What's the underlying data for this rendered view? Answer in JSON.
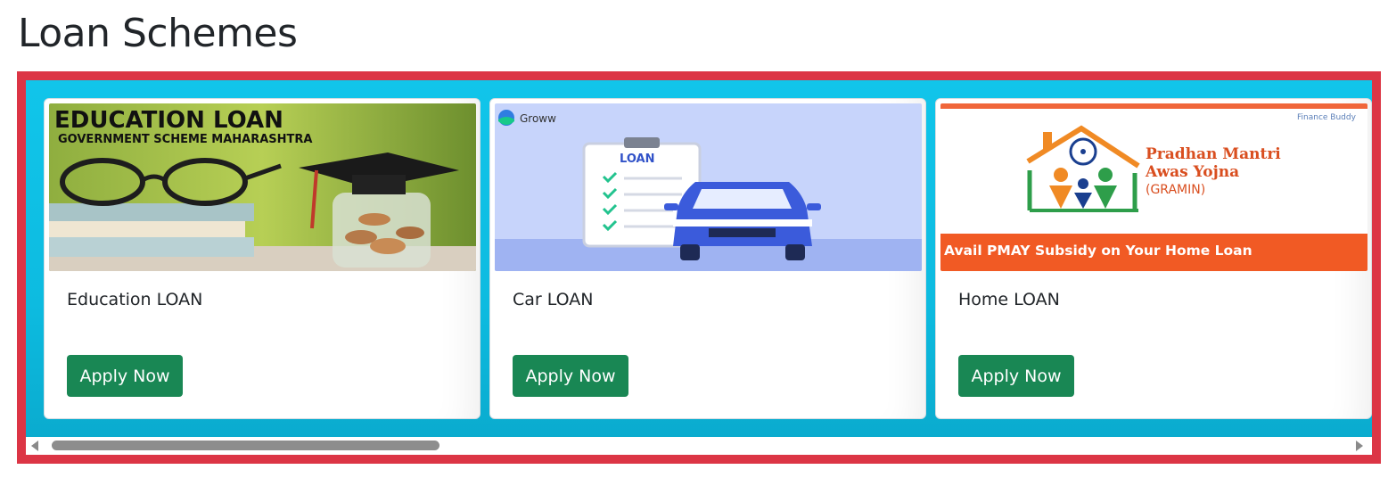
{
  "page": {
    "title": "Loan Schemes"
  },
  "colors": {
    "frame_border": "#dc3545",
    "frame_bg": "#11c5ea",
    "button_bg": "#198754"
  },
  "cards": [
    {
      "title": "Education LOAN",
      "button_label": "Apply Now",
      "image": {
        "headline": "EDUCATION LOAN",
        "subline": "GOVERNMENT SCHEME MAHARASHTRA"
      }
    },
    {
      "title": "Car LOAN",
      "button_label": "Apply Now",
      "image": {
        "brand": "Groww",
        "clipboard_label": "LOAN"
      }
    },
    {
      "title": "Home LOAN",
      "button_label": "Apply Now",
      "image": {
        "watermark": "Finance Buddy",
        "line1": "Pradhan Mantri",
        "line2": "Awas Yojna",
        "line3": "(GRAMIN)",
        "banner": "Avail PMAY Subsidy on Your Home Loan"
      }
    }
  ],
  "scrollbar": {
    "position_fraction": 0.0,
    "visible_fraction": 0.3
  }
}
